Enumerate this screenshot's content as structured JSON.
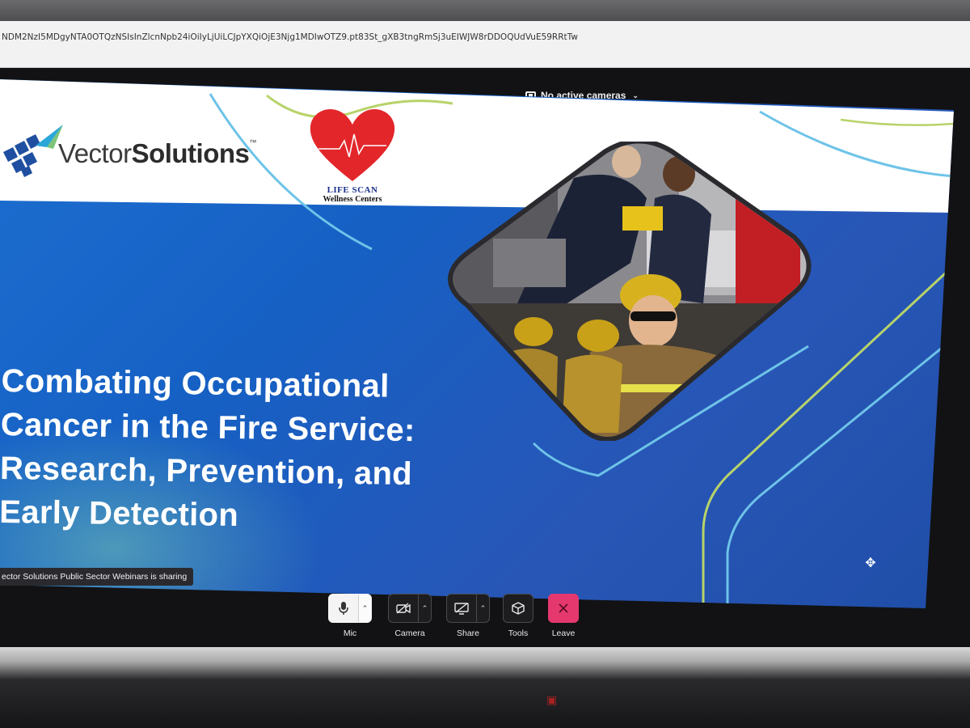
{
  "browser": {
    "url": "NDM2NzI5MDgyNTA0OTQzNSIsInZlcnNpb24iOiIyLjUiLCJpYXQiOjE3Njg1MDIwOTZ9.pt83St_gXB3tngRmSj3uEIWJW8rDDOQUdVuE59RRtTw"
  },
  "meeting": {
    "camera_status": "No active cameras",
    "sharing_text": "ector Solutions Public Sector Webinars is sharing"
  },
  "slide": {
    "logo_left": {
      "brand_regular": "Vector",
      "brand_bold": "Solutions",
      "tm": "™"
    },
    "logo_right": {
      "name": "LIFE SCAN",
      "sub": "Wellness Centers"
    },
    "title_lines": [
      "Combating Occupational",
      "Cancer in the Fire Service:",
      "Research, Prevention, and",
      "Early Detection"
    ],
    "colors": {
      "slide_blue": "#1c6fd0",
      "line_blue": "#6ec3e8",
      "line_green": "#b8d36a",
      "heart_red": "#e3262a",
      "leave_pink": "#e5386f"
    }
  },
  "toolbar": {
    "mic": {
      "label": "Mic",
      "icon": "microphone-icon"
    },
    "camera": {
      "label": "Camera",
      "icon": "camera-off-icon"
    },
    "share": {
      "label": "Share",
      "icon": "screen-share-icon"
    },
    "tools": {
      "label": "Tools",
      "icon": "cube-icon"
    },
    "leave": {
      "label": "Leave",
      "icon": "close-icon"
    }
  }
}
